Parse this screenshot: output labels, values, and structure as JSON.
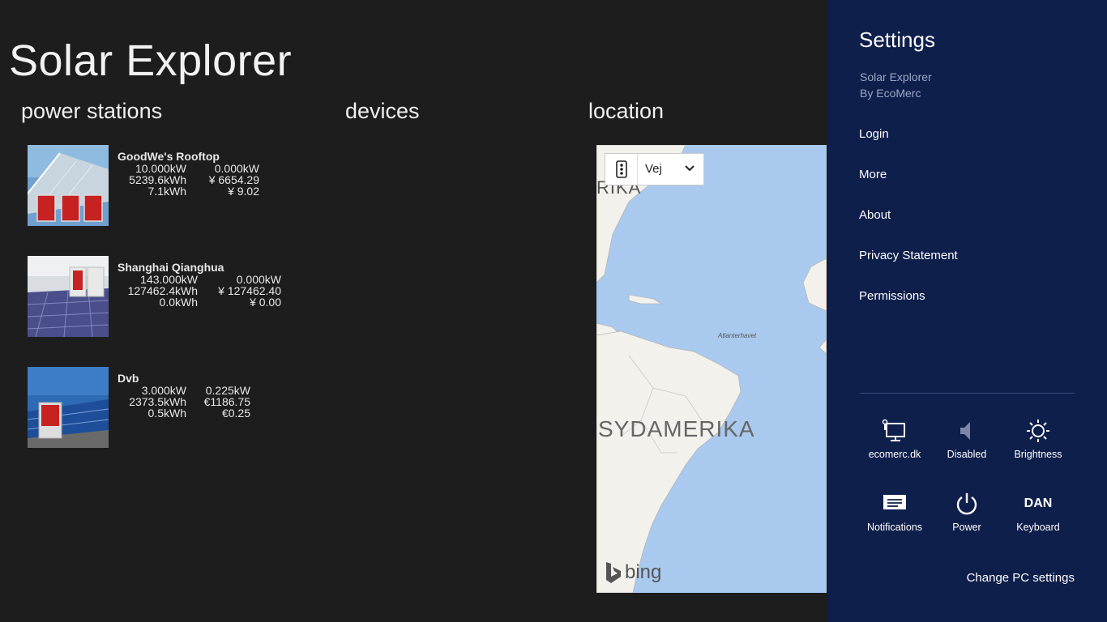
{
  "app": {
    "title": "Solar Explorer"
  },
  "sections": {
    "stations": "power stations",
    "devices": "devices",
    "location": "location"
  },
  "stations": [
    {
      "name": "GoodWe's Rooftop",
      "power": "10.000kW",
      "power2": "0.000kW",
      "energy": "5239.6kWh",
      "income": "¥ 6654.29",
      "today": "7.1kWh",
      "today_income": "¥ 9.02"
    },
    {
      "name": "Shanghai Qianghua",
      "power": "143.000kW",
      "power2": "0.000kW",
      "energy": "127462.4kWh",
      "income": "¥ 127462.40",
      "today": "0.0kWh",
      "today_income": "¥ 0.00"
    },
    {
      "name": "Dvb",
      "power": "3.000kW",
      "power2": "0.225kW",
      "energy": "2373.5kWh",
      "income": "€1186.75",
      "today": "0.5kWh",
      "today_income": "€0.25"
    }
  ],
  "map": {
    "mode": "Vej",
    "labels": {
      "rika": "RIKA",
      "atlantic": "Atlanterhavet",
      "south_america": "SYDAMERIKA"
    },
    "provider": "bing"
  },
  "settings": {
    "title": "Settings",
    "app_name": "Solar Explorer",
    "publisher": "By EcoMerc",
    "links": [
      "Login",
      "More",
      "About",
      "Privacy Statement",
      "Permissions"
    ],
    "quick": [
      {
        "label": "ecomerc.dk",
        "icon": "network-icon"
      },
      {
        "label": "Disabled",
        "icon": "volume-icon"
      },
      {
        "label": "Brightness",
        "icon": "brightness-icon"
      },
      {
        "label": "Notifications",
        "icon": "notifications-icon"
      },
      {
        "label": "Power",
        "icon": "power-icon"
      },
      {
        "label": "DAN",
        "sublabel": "Keyboard",
        "icon": "keyboard-icon"
      }
    ],
    "change_pc": "Change PC settings"
  }
}
